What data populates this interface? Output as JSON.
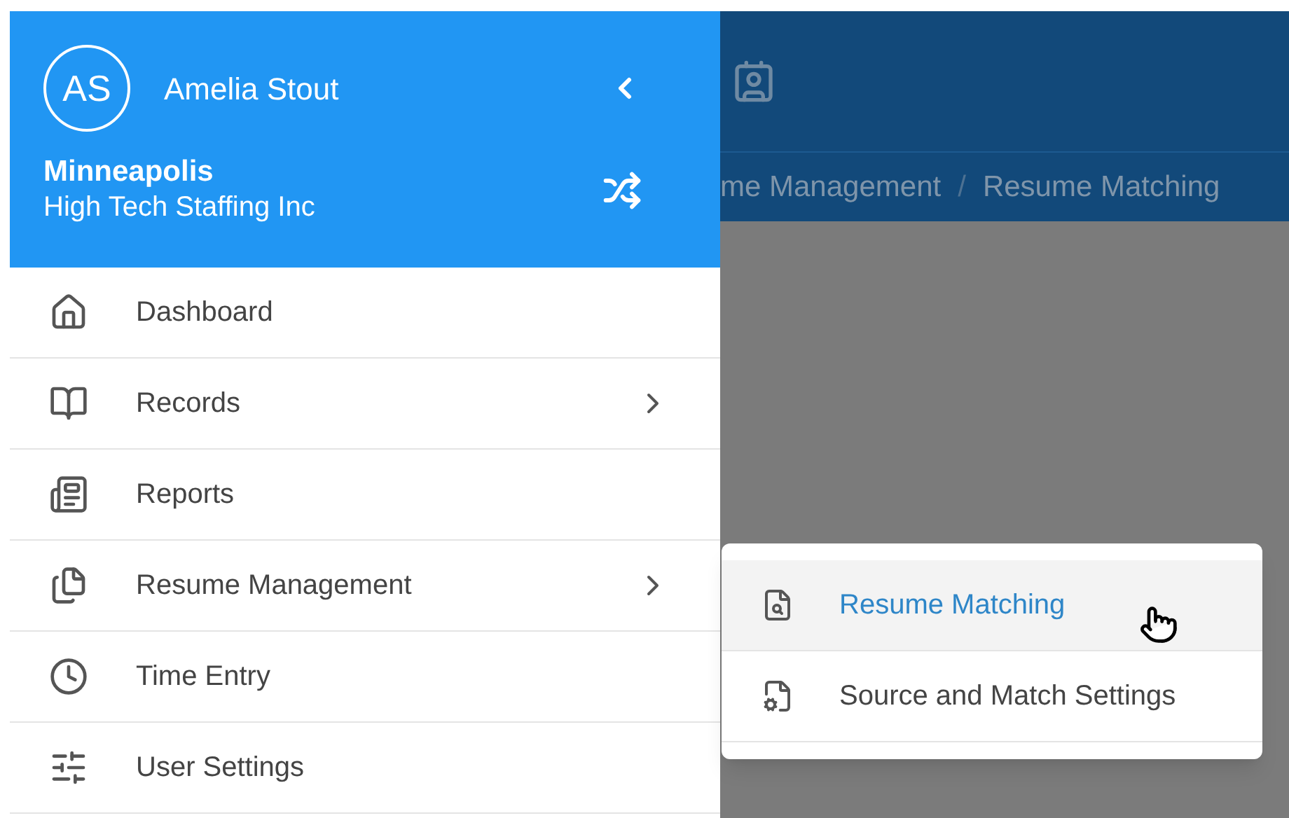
{
  "drawer": {
    "user": {
      "initials": "AS",
      "name": "Amelia Stout"
    },
    "location": "Minneapolis",
    "company": "High Tech Staffing Inc",
    "items": [
      {
        "label": "Dashboard",
        "kind": "link"
      },
      {
        "label": "Records",
        "kind": "submenu"
      },
      {
        "label": "Reports",
        "kind": "link"
      },
      {
        "label": "Resume Management",
        "kind": "submenu"
      },
      {
        "label": "Time Entry",
        "kind": "link"
      },
      {
        "label": "User Settings",
        "kind": "link"
      }
    ]
  },
  "app_bar": {
    "breadcrumb": [
      "me Management",
      "Resume Matching"
    ],
    "separator": "/"
  },
  "submenu": {
    "items": [
      {
        "label": "Resume Matching",
        "selected": true
      },
      {
        "label": "Source and Match Settings",
        "selected": false
      }
    ]
  }
}
